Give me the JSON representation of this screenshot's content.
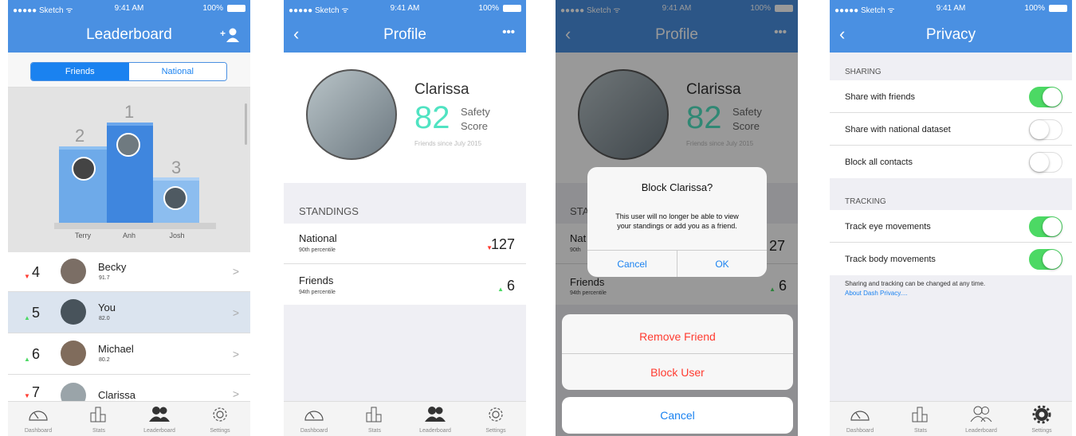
{
  "status": {
    "carrier": "●●●●● Sketch ᯤ",
    "time": "9:41 AM",
    "battery": "100%"
  },
  "tabs": [
    {
      "label": "Dashboard",
      "icon": "dashboard-gauge-icon"
    },
    {
      "label": "Stats",
      "icon": "stats-bars-icon"
    },
    {
      "label": "Leaderboard",
      "icon": "leaderboard-people-icon"
    },
    {
      "label": "Settings",
      "icon": "settings-gear-icon"
    }
  ],
  "leaderboard": {
    "title": "Leaderboard",
    "add_icon": "add-friend-icon",
    "segments": [
      "Friends",
      "National"
    ],
    "active_segment": "Friends",
    "podium": [
      {
        "rank": "2",
        "name": "Terry"
      },
      {
        "rank": "1",
        "name": "Anh"
      },
      {
        "rank": "3",
        "name": "Josh"
      }
    ],
    "rows": [
      {
        "rank": "4",
        "trend": "down",
        "name": "Becky",
        "score": "91.7"
      },
      {
        "rank": "5",
        "trend": "up",
        "name": "You",
        "score": "82.0"
      },
      {
        "rank": "6",
        "trend": "up",
        "name": "Michael",
        "score": "80.2"
      },
      {
        "rank": "7",
        "trend": "down",
        "name": "Clarissa",
        "score": ""
      }
    ]
  },
  "profile": {
    "title": "Profile",
    "more": "•••",
    "name": "Clarissa",
    "score": "82",
    "score_label_1": "Safety",
    "score_label_2": "Score",
    "since": "Friends since July 2015",
    "standings_header": "STANDINGS",
    "standings": [
      {
        "label": "National",
        "percentile": "90th percentile",
        "trend": "down",
        "value": "127"
      },
      {
        "label": "Friends",
        "percentile": "94th percentile",
        "trend": "up",
        "value": "6"
      }
    ]
  },
  "block_dialog": {
    "title": "Block Clarissa?",
    "message_1": "This user will no longer be able to view",
    "message_2": "your standings or add you as a friend.",
    "cancel": "Cancel",
    "ok": "OK",
    "bg_header": "STA",
    "bg_national": "Nat",
    "bg_national_pct": "90th",
    "bg_national_val": "27",
    "bg_friends": "Friends",
    "bg_friends_pct": "94th percentile",
    "bg_friends_val": "6"
  },
  "action_sheet": {
    "remove": "Remove Friend",
    "block": "Block User",
    "cancel": "Cancel"
  },
  "privacy": {
    "title": "Privacy",
    "sharing_header": "SHARING",
    "sharing": [
      {
        "label": "Share with friends",
        "on": true
      },
      {
        "label": "Share with national dataset",
        "on": false
      },
      {
        "label": "Block all contacts",
        "on": false
      }
    ],
    "tracking_header": "TRACKING",
    "tracking": [
      {
        "label": "Track eye movements",
        "on": true
      },
      {
        "label": "Track body movements",
        "on": true
      }
    ],
    "footer": "Sharing and tracking can be changed at any time.",
    "link": "About Dash Privacy...."
  },
  "colors": {
    "accent": "#4a90e2",
    "green": "#4cd964",
    "red": "#ff3b30",
    "teal": "#50e3c2"
  }
}
